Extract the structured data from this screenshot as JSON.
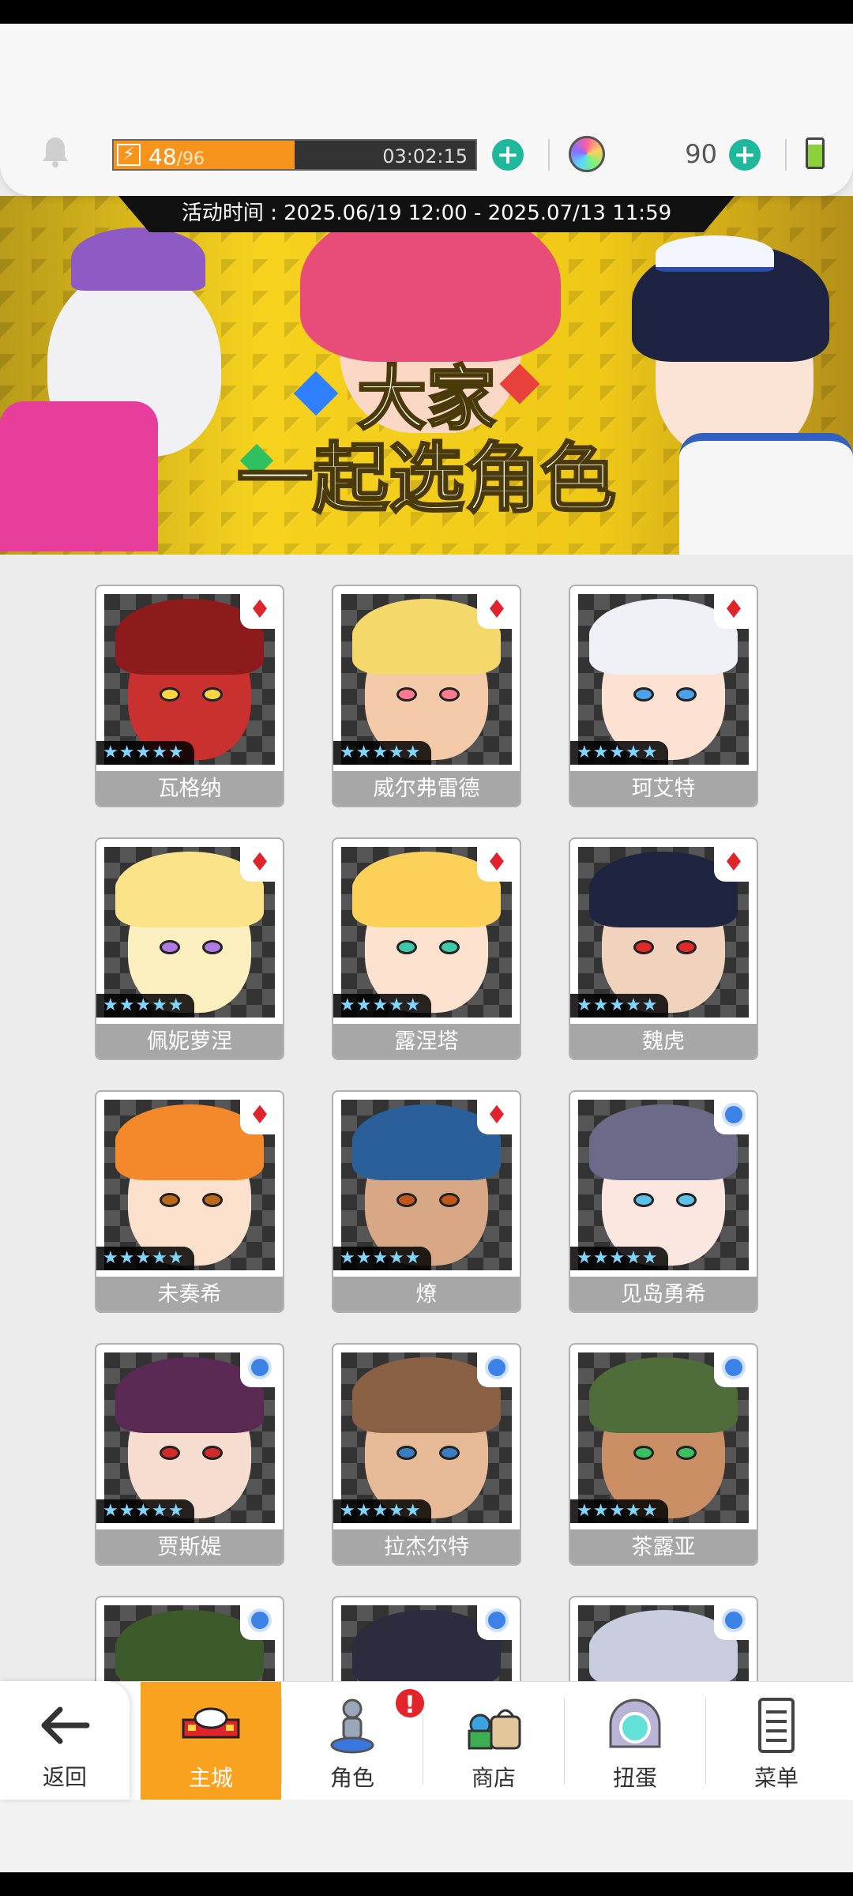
{
  "topbar": {
    "stamina": {
      "current": "48",
      "max": "/96",
      "fraction": 0.5,
      "timer": "03:02:15"
    },
    "gems": "90"
  },
  "banner": {
    "event_time": "活动时间 : 2025.06/19 12:00 - 2025.07/13 11:59",
    "title_line1": "大家",
    "title_line2": "一起选角色"
  },
  "roster": {
    "characters": [
      {
        "name": "瓦格纳",
        "stars": "★★★★★",
        "badge": "red",
        "colors": {
          "face": "#c8312e",
          "hair": "#8d1b1b",
          "eye": "#ffd640"
        }
      },
      {
        "name": "威尔弗雷德",
        "stars": "★★★★★",
        "badge": "red",
        "colors": {
          "face": "#f4c9a8",
          "hair": "#f4d86a",
          "eye": "#ff7a90"
        }
      },
      {
        "name": "珂艾特",
        "stars": "★★★★★",
        "badge": "red",
        "colors": {
          "face": "#fde2d4",
          "hair": "#eef0f6",
          "eye": "#4aa3e8"
        }
      },
      {
        "name": "佩妮萝涅",
        "stars": "★★★★★",
        "badge": "red",
        "colors": {
          "face": "#fcefc0",
          "hair": "#fbe38a",
          "eye": "#b07be0"
        }
      },
      {
        "name": "露涅塔",
        "stars": "★★★★★",
        "badge": "red",
        "colors": {
          "face": "#fde3cf",
          "hair": "#fbd15a",
          "eye": "#3ecaa8"
        }
      },
      {
        "name": "魏虎",
        "stars": "★★★★★",
        "badge": "red",
        "colors": {
          "face": "#f1d2bd",
          "hair": "#1f2540",
          "eye": "#e02a2a"
        }
      },
      {
        "name": "未奏希",
        "stars": "★★★★★",
        "badge": "red",
        "colors": {
          "face": "#fbe0cb",
          "hair": "#f3892a",
          "eye": "#b86a1a"
        }
      },
      {
        "name": "燎",
        "stars": "★★★★★",
        "badge": "red",
        "colors": {
          "face": "#d8a786",
          "hair": "#2a5f9a",
          "eye": "#c0561c"
        }
      },
      {
        "name": "见岛勇希",
        "stars": "★★★★★",
        "badge": "blue",
        "colors": {
          "face": "#fbe6e0",
          "hair": "#6b6a88",
          "eye": "#5cc0e8"
        }
      },
      {
        "name": "贾斯媞",
        "stars": "★★★★★",
        "badge": "blue",
        "colors": {
          "face": "#f7dcd0",
          "hair": "#5a2a55",
          "eye": "#d02a2a"
        }
      },
      {
        "name": "拉杰尔特",
        "stars": "★★★★★",
        "badge": "blue",
        "colors": {
          "face": "#e6b997",
          "hair": "#8a6045",
          "eye": "#3c7cc0"
        }
      },
      {
        "name": "茶露亚",
        "stars": "★★★★★",
        "badge": "blue",
        "colors": {
          "face": "#c98e64",
          "hair": "#4e6d3a",
          "eye": "#3cbf60"
        }
      },
      {
        "name": "",
        "stars": "",
        "badge": "blue",
        "colors": {
          "face": "#d9e3a0",
          "hair": "#3d5a2a",
          "eye": "#333"
        }
      },
      {
        "name": "",
        "stars": "",
        "badge": "blue",
        "colors": {
          "face": "#f5dccb",
          "hair": "#2c2c3e",
          "eye": "#333"
        }
      },
      {
        "name": "",
        "stars": "",
        "badge": "blue",
        "colors": {
          "face": "#eef0f8",
          "hair": "#c8ccdc",
          "eye": "#333"
        }
      }
    ]
  },
  "nav": {
    "back": "返回",
    "items": [
      {
        "label": "主城",
        "active": true
      },
      {
        "label": "角色",
        "active": false,
        "alert": "!"
      },
      {
        "label": "商店",
        "active": false
      },
      {
        "label": "扭蛋",
        "active": false
      },
      {
        "label": "菜单",
        "active": false
      }
    ]
  }
}
